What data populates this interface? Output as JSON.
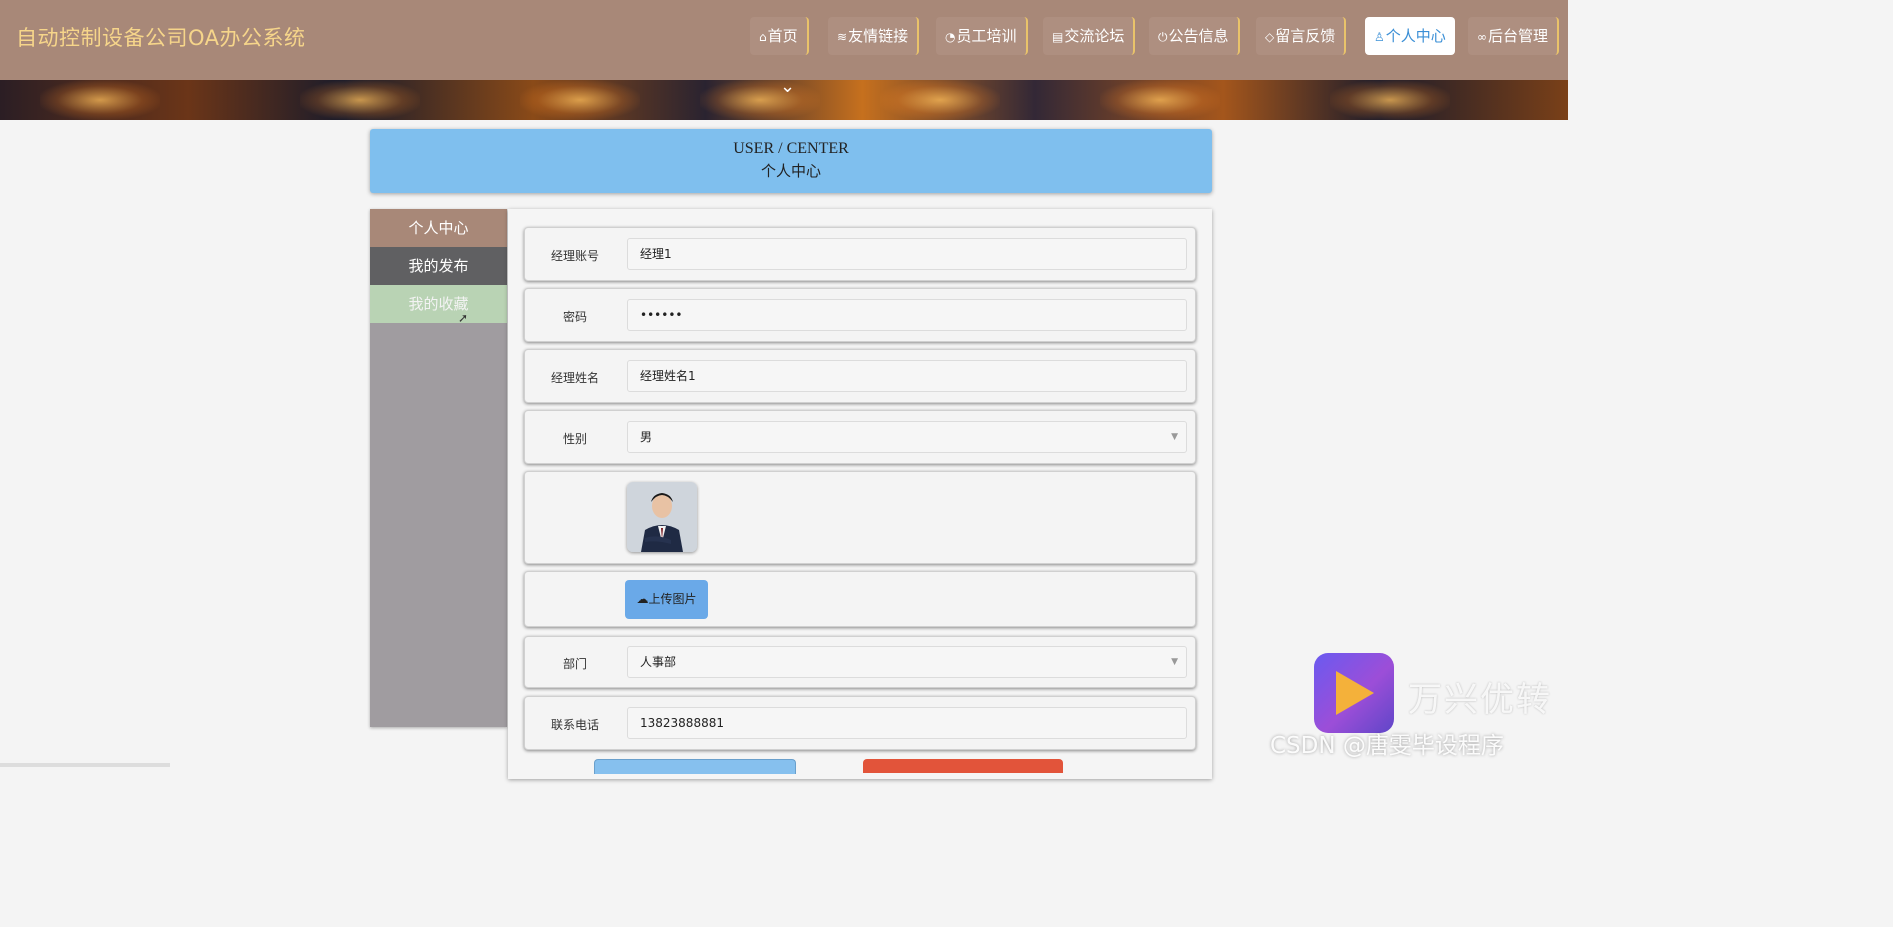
{
  "app": {
    "title": "自动控制设备公司OA办公系统"
  },
  "nav": {
    "items": [
      {
        "icon": "home-icon",
        "glyph": "⌂",
        "label": "首页"
      },
      {
        "icon": "layers-icon",
        "glyph": "≋",
        "label": "友情链接"
      },
      {
        "icon": "palette-icon",
        "glyph": "◔",
        "label": "员工培训"
      },
      {
        "icon": "clipboard-icon",
        "glyph": "▤",
        "label": "交流论坛"
      },
      {
        "icon": "power-icon",
        "glyph": "⏻",
        "label": "公告信息"
      },
      {
        "icon": "tag-icon",
        "glyph": "◇",
        "label": "留言反馈"
      },
      {
        "icon": "user-icon",
        "glyph": "♙",
        "label": "个人中心",
        "active": true
      },
      {
        "icon": "link-icon",
        "glyph": "∞",
        "label": "后台管理"
      }
    ]
  },
  "banner": {
    "chevron_icon": "chevron-down-icon",
    "chevron": "⌄"
  },
  "header": {
    "title_en": "USER / CENTER",
    "title_cn": "个人中心"
  },
  "sidebar": {
    "items": [
      {
        "label": "个人中心"
      },
      {
        "label": "我的发布"
      },
      {
        "label": "我的收藏"
      }
    ]
  },
  "form": {
    "account": {
      "label": "经理账号",
      "value": "经理1"
    },
    "password": {
      "label": "密码",
      "value": "••••••"
    },
    "name": {
      "label": "经理姓名",
      "value": "经理姓名1"
    },
    "gender": {
      "label": "性别",
      "value": "男"
    },
    "upload": {
      "icon": "cloud-upload-icon",
      "glyph": "☁",
      "label": "上传图片"
    },
    "department": {
      "label": "部门",
      "value": "人事部"
    },
    "phone": {
      "label": "联系电话",
      "value": "13823888881"
    }
  },
  "watermark": {
    "brand": "万兴优转",
    "credit": "CSDN @唐雯毕设程序"
  },
  "colors": {
    "topbar": "#a88878",
    "brand_text": "#f6d58a",
    "header_box": "#7fbfee",
    "save_button": "#86c0ee",
    "reset_button": "#e2543a"
  }
}
